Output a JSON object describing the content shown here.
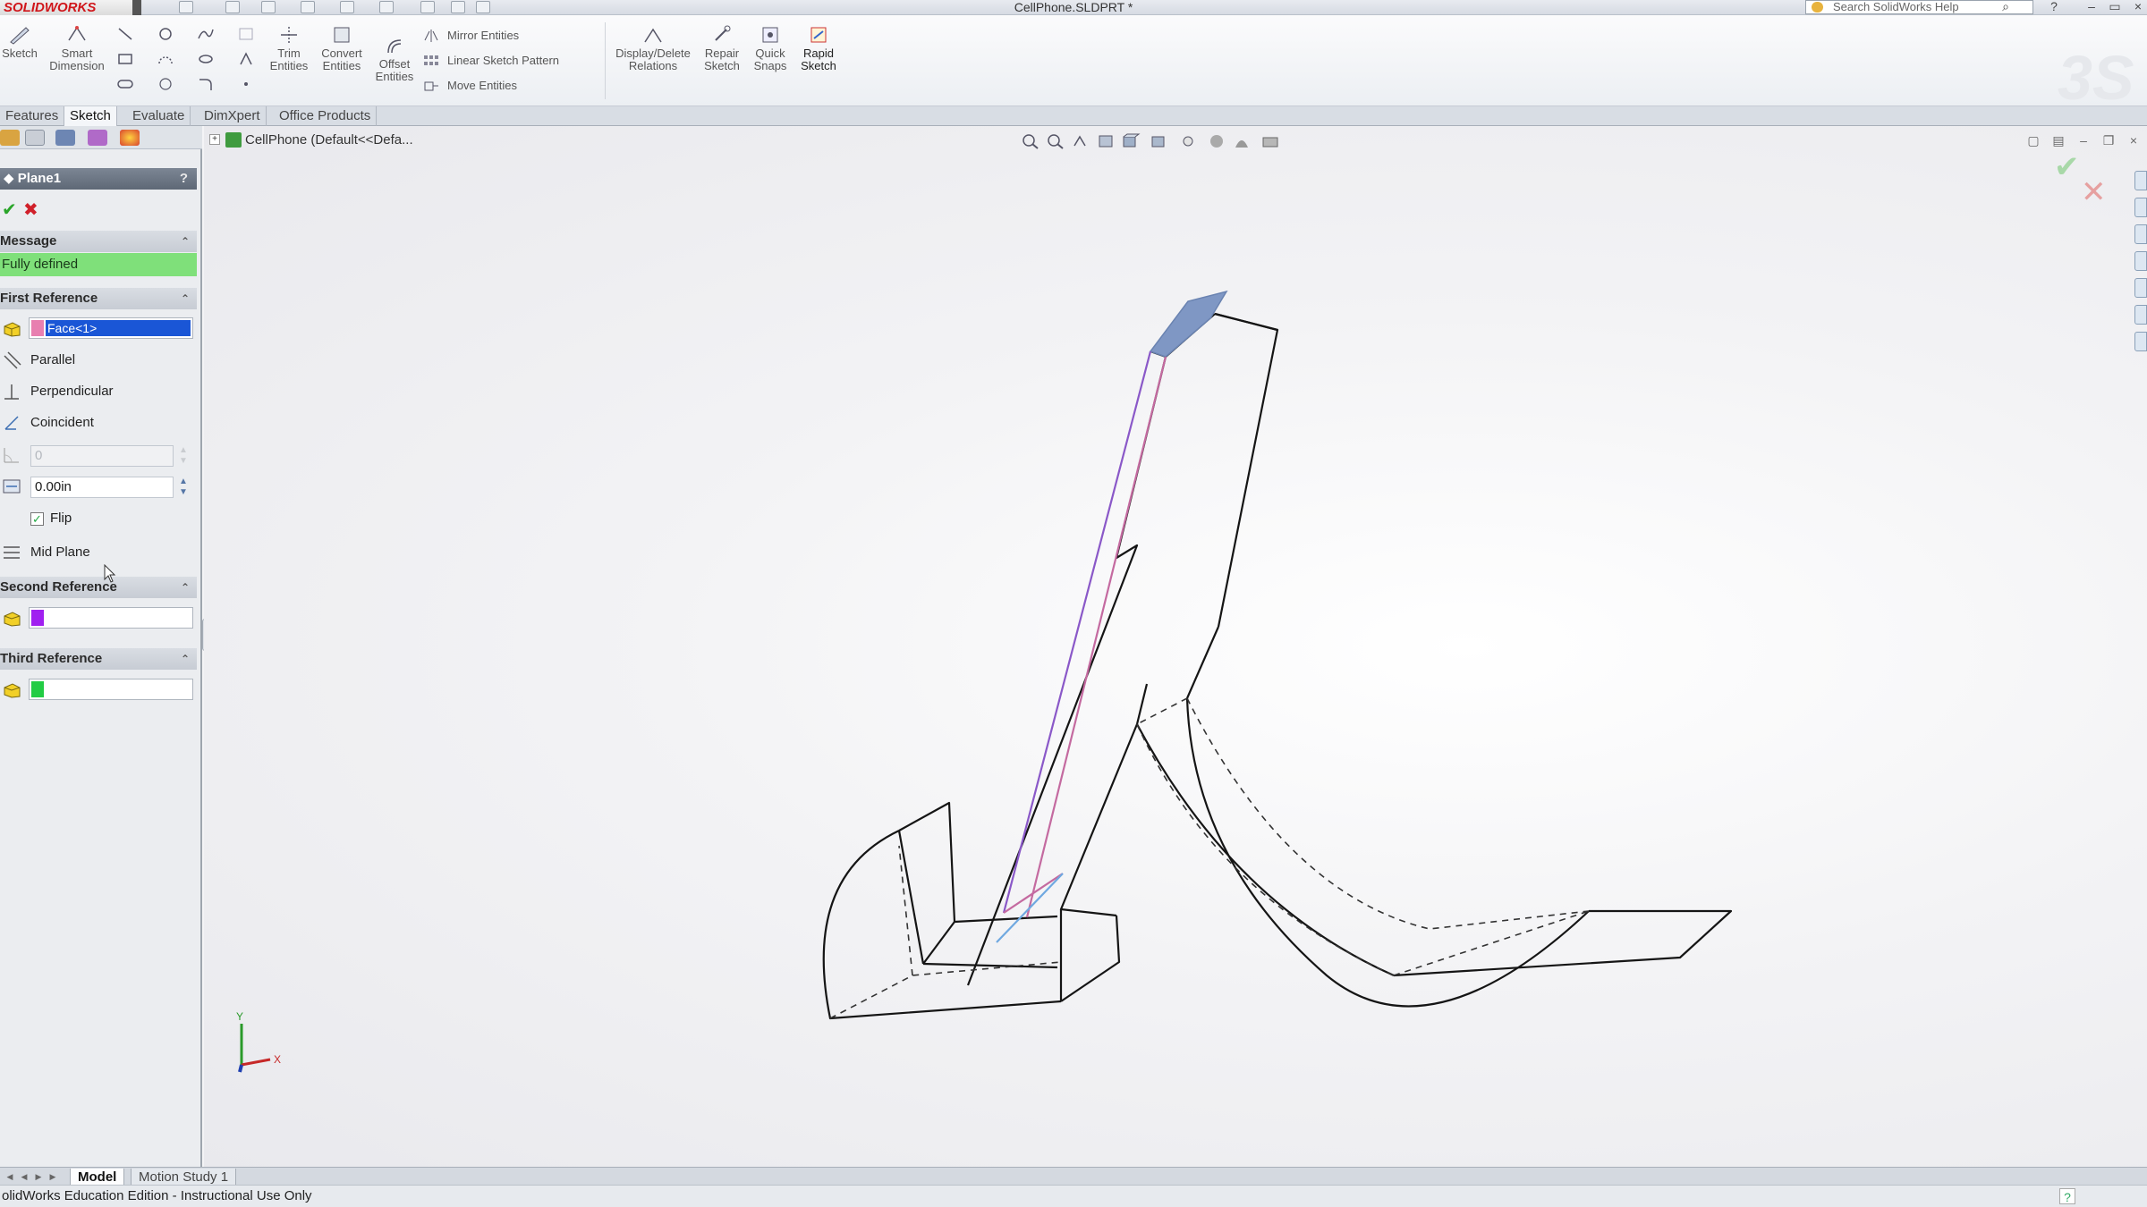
{
  "app": {
    "logo_text": "SOLIDWORKS",
    "document_title": "CellPhone.SLDPRT *",
    "search_placeholder": "Search SolidWorks Help"
  },
  "toolbar": {
    "sketch": "Sketch",
    "smart_dimension_l1": "Smart",
    "smart_dimension_l2": "Dimension",
    "trim_l1": "Trim",
    "trim_l2": "Entities",
    "convert_l1": "Convert",
    "convert_l2": "Entities",
    "offset_l1": "Offset",
    "offset_l2": "Entities",
    "mirror": "Mirror Entities",
    "linear_pattern": "Linear Sketch Pattern",
    "move": "Move Entities",
    "display_delete_l1": "Display/Delete",
    "display_delete_l2": "Relations",
    "repair_l1": "Repair",
    "repair_l2": "Sketch",
    "quick_snaps_l1": "Quick",
    "quick_snaps_l2": "Snaps",
    "rapid_sketch_l1": "Rapid",
    "rapid_sketch_l2": "Sketch"
  },
  "tabs": [
    "Features",
    "Sketch",
    "Evaluate",
    "DimXpert",
    "Office Products"
  ],
  "panel": {
    "title": "Plane1",
    "help": "?",
    "message_header": "Message",
    "message_text": "Fully defined",
    "first_reference_header": "First Reference",
    "first_reference_value": "Face<1>",
    "first_reference_color": "#e87fb0",
    "options": [
      "Parallel",
      "Perpendicular",
      "Coincident"
    ],
    "angle_value": "0",
    "distance_value": "0.00in",
    "flip_label": "Flip",
    "flip_checked": "✓",
    "mid_plane_label": "Mid Plane",
    "second_reference_header": "Second Reference",
    "second_reference_color": "#a020f0",
    "third_reference_header": "Third Reference",
    "third_reference_color": "#22cc44"
  },
  "viewport": {
    "tree_root": "CellPhone  (Default<<Defa..."
  },
  "bottom_tabs": [
    "Model",
    "Motion Study 1"
  ],
  "status": {
    "text": "olidWorks Education Edition - Instructional Use Only"
  },
  "colors": {
    "accent_blue": "#1a56d6",
    "selected_face": "#7f97c4"
  }
}
